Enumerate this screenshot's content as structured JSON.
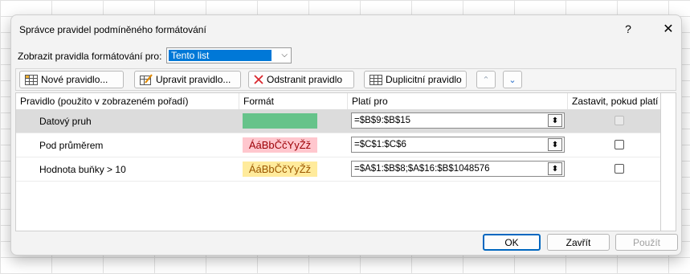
{
  "dialog": {
    "title": "Správce pravidel podmíněného formátování",
    "help": "?",
    "close": "✕"
  },
  "show": {
    "label": "Zobrazit pravidla formátování pro:",
    "value": "Tento list"
  },
  "toolbar": {
    "new": "Nové pravidlo...",
    "edit": "Upravit pravidlo...",
    "delete": "Odstranit pravidlo",
    "duplicate": "Duplicitní pravidlo"
  },
  "table": {
    "headers": [
      "Pravidlo (použito v zobrazeném pořadí)",
      "Formát",
      "Platí pro",
      "Zastavit, pokud platí"
    ],
    "rows": [
      {
        "name": "Datový pruh",
        "format": "",
        "applies": "=$B$9:$B$15",
        "stop_checked": false,
        "stop_enabled": false
      },
      {
        "name": "Pod průměrem",
        "format": "ÁáBbČčYyŽž",
        "applies": "=$C$1:$C$6",
        "stop_checked": false,
        "stop_enabled": true
      },
      {
        "name": "Hodnota buňky > 10",
        "format": "ÁáBbČčYyŽž",
        "applies": "=$A$1:$B$8;$A$16:$B$1048576",
        "stop_checked": false,
        "stop_enabled": true
      }
    ]
  },
  "footer": {
    "ok": "OK",
    "close": "Zavřít",
    "apply": "Použít"
  },
  "colors": {
    "data_bar": "#66c38a",
    "below_avg_fill": "#ffc7ce",
    "below_avg_text": "#9c0006",
    "cell_value_fill": "#ffeb9c",
    "cell_value_text": "#9c5700",
    "selection": "#0078d7"
  }
}
